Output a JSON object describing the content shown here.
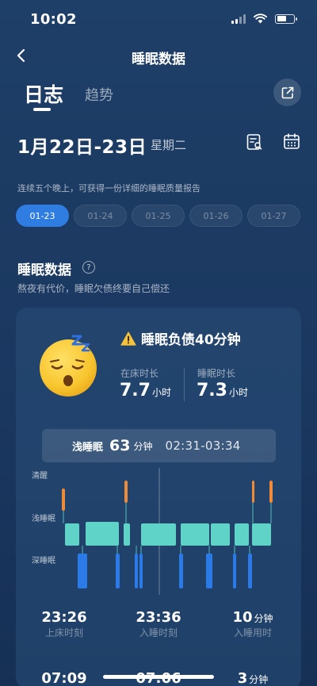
{
  "status_bar": {
    "time": "10:02"
  },
  "header": {
    "title": "睡眠数据"
  },
  "tabs": [
    {
      "label": "日志",
      "active": true
    },
    {
      "label": "趋势",
      "active": false
    }
  ],
  "date": {
    "range": "1月22日-23日",
    "weekday": "星期二"
  },
  "report_hint": "连续五个晚上，可获得一份详细的睡眠质量报告",
  "date_chips": [
    {
      "label": "01-23",
      "active": true
    },
    {
      "label": "01-24",
      "active": false
    },
    {
      "label": "01-25",
      "active": false
    },
    {
      "label": "01-26",
      "active": false
    },
    {
      "label": "01-27",
      "active": false
    }
  ],
  "section": {
    "title": "睡眠数据",
    "subtitle": "熬夜有代价，睡眠欠债终要自己偿还"
  },
  "card": {
    "debt_warning": "睡眠负债40分钟",
    "emoji_icon": "sleeping-face-icon",
    "in_bed": {
      "label": "在床时长",
      "value": "7.7",
      "unit": "小时"
    },
    "asleep": {
      "label": "睡眠时长",
      "value": "7.3",
      "unit": "小时"
    },
    "tooltip": {
      "stage": "浅睡眠",
      "minutes": "63",
      "unit": "分钟",
      "range": "02:31-03:34"
    },
    "hypnogram": {
      "levels": [
        "清醒",
        "浅睡眠",
        "深睡眠"
      ],
      "colors": {
        "awake": "#ee8a3a",
        "light": "#5fd3c8",
        "deep": "#2c7ae8"
      }
    }
  },
  "metrics": [
    {
      "value": "23:26",
      "unit": "",
      "label": "上床时刻"
    },
    {
      "value": "23:36",
      "unit": "",
      "label": "入睡时刻"
    },
    {
      "value": "10",
      "unit": "分钟",
      "label": "入睡用时"
    },
    {
      "value": "07:09",
      "unit": "",
      "label": ""
    },
    {
      "value": "07:06",
      "unit": "",
      "label": ""
    },
    {
      "value": "3",
      "unit": "分钟",
      "label": ""
    }
  ]
}
